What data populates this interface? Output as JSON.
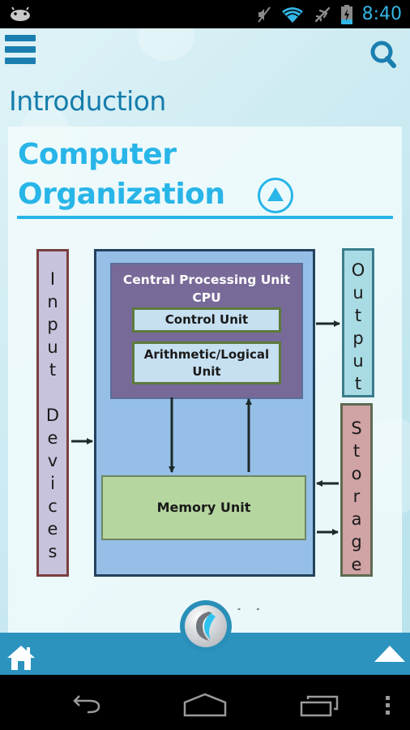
{
  "status_bar": {
    "time": "8:40",
    "icons": [
      "android-debug-icon",
      "mute-icon",
      "wifi-icon",
      "airplane-mode-icon",
      "battery-charging-icon"
    ],
    "time_color": "#33b5e5"
  },
  "header": {
    "menu_icon": "hamburger-menu-icon",
    "search_icon": "search-icon",
    "page_title": "Introduction"
  },
  "card": {
    "title_line1": "Computer",
    "title_line2": "Organization",
    "collapse_icon": "collapse-up-icon",
    "accent_color": "#28b5e8"
  },
  "diagram": {
    "input_devices": [
      "I",
      "n",
      "p",
      "u",
      "t",
      "",
      "D",
      "e",
      "v",
      "i",
      "c",
      "e",
      "s"
    ],
    "output": [
      "O",
      "u",
      "t",
      "p",
      "u",
      "t"
    ],
    "storage": [
      "S",
      "t",
      "o",
      "r",
      "a",
      "g",
      "e"
    ],
    "cpu_line1": "Central Processing Unit",
    "cpu_line2": "CPU",
    "control_unit": "Control Unit",
    "alu_line1": "Arithmetic/Logical",
    "alu_line2": "Unit",
    "memory_unit": "Memory Unit"
  },
  "page_indicator": "- -",
  "bottom_bar": {
    "home_icon": "home-icon",
    "logo_icon": "app-logo-icon",
    "up_icon": "scroll-up-icon",
    "color": "#2c93bf"
  },
  "nav_bar": {
    "buttons": [
      "back-icon",
      "home-icon",
      "recent-apps-icon",
      "overflow-menu-icon"
    ]
  }
}
